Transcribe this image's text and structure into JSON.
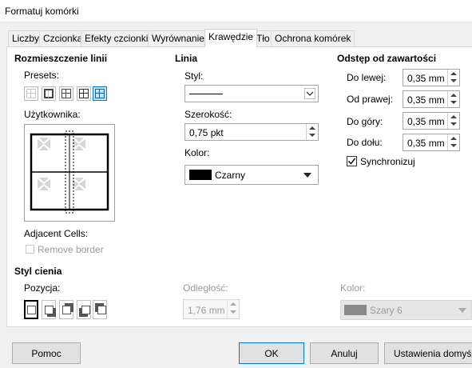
{
  "window": {
    "title": "Formatuj komórki"
  },
  "tabs": [
    "Liczby",
    "Czcionka",
    "Efekty czcionki",
    "Wyrównanie",
    "Krawędzie",
    "Tło",
    "Ochrona komórek"
  ],
  "active_tab": "Krawędzie",
  "line_arrangement": {
    "heading": "Rozmieszczenie linii",
    "presets_label": "Presets:",
    "user_label": "Użytkownika:",
    "adjacent_label": "Adjacent Cells:",
    "remove_border_label": "Remove border",
    "remove_border_checked": false
  },
  "line": {
    "heading": "Linia",
    "style_label": "Styl:",
    "width_label": "Szerokość:",
    "width_value": "0,75 pkt",
    "color_label": "Kolor:",
    "color_value": "Czarny",
    "color_hex": "#000000"
  },
  "padding": {
    "heading": "Odstęp od zawartości",
    "left_label": "Do lewej:",
    "left_value": "0,35 mm",
    "right_label": "Od prawej:",
    "right_value": "0,35 mm",
    "top_label": "Do góry:",
    "top_value": "0,35 mm",
    "bottom_label": "Do dołu:",
    "bottom_value": "0,35 mm",
    "sync_label": "Synchronizuj",
    "sync_checked": true
  },
  "shadow": {
    "heading": "Styl cienia",
    "position_label": "Pozycja:",
    "distance_label": "Odległość:",
    "distance_value": "1,76 mm",
    "color_label": "Kolor:",
    "color_value": "Szary 6",
    "color_hex": "#808080"
  },
  "buttons": {
    "help": "Pomoc",
    "ok": "OK",
    "cancel": "Anuluj",
    "defaults": "Ustawienia domyślne"
  },
  "colors": {
    "accent": "#0078d7",
    "panel_bg": "#ffffff",
    "dialog_bg": "#f0f0f0"
  }
}
